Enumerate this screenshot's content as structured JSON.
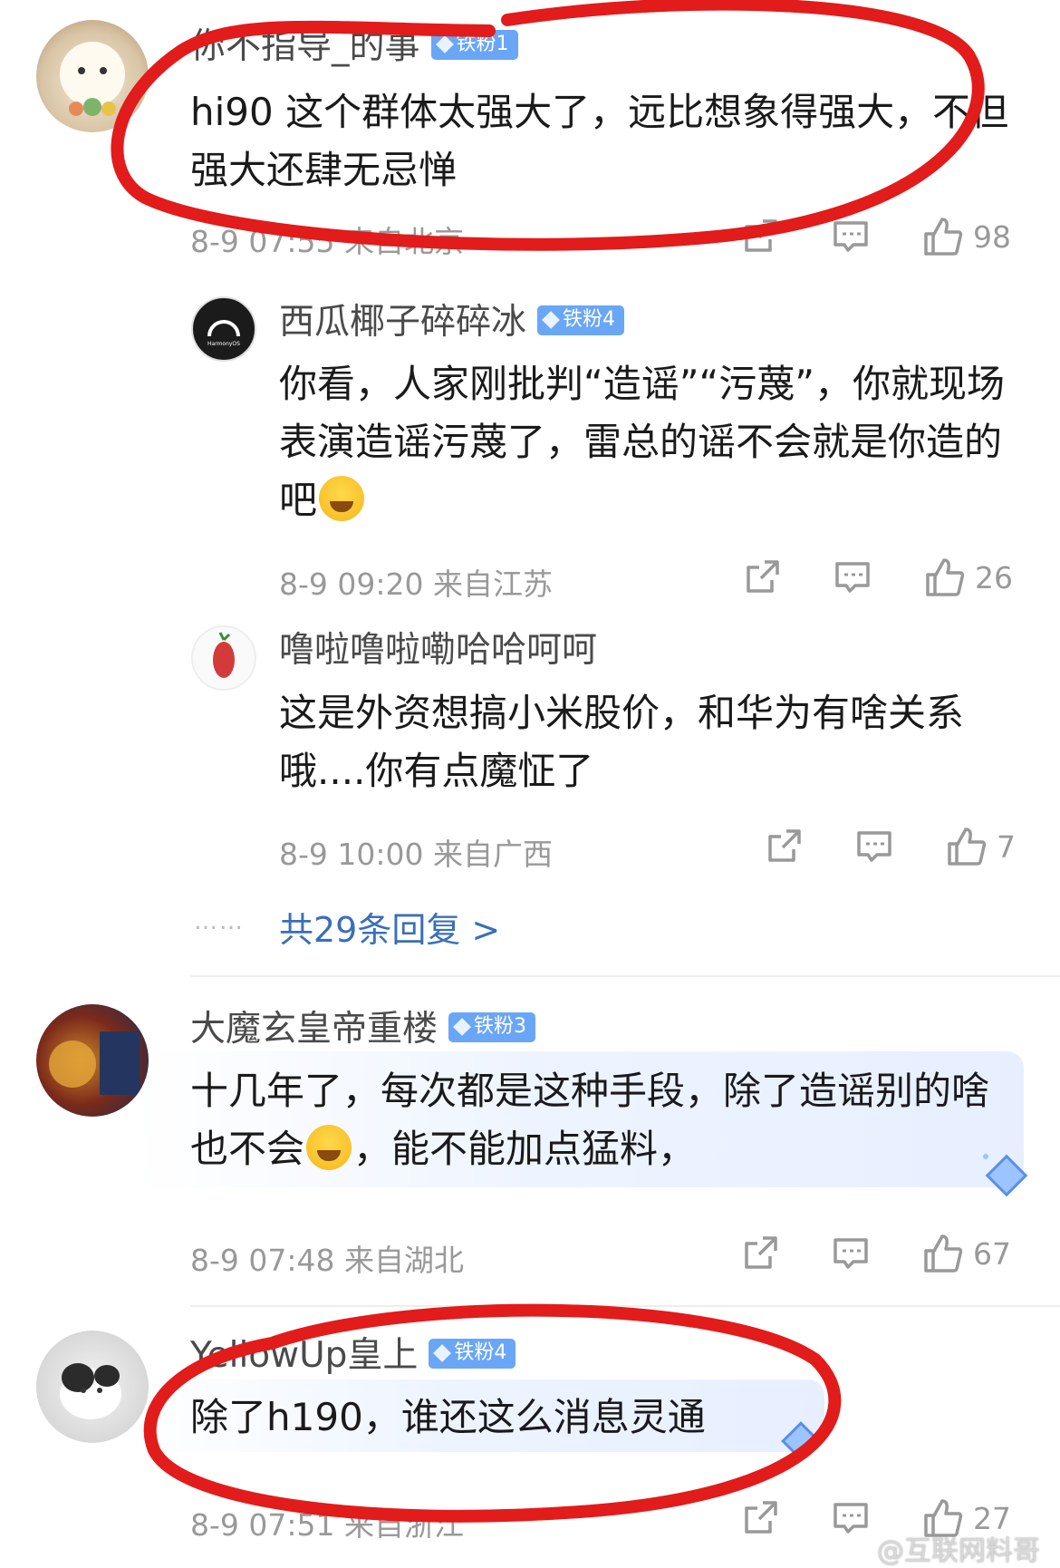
{
  "comments": [
    {
      "username": "你不指导_的事",
      "badge": "铁粉1",
      "text": "hi90 这个群体太强大了，远比想象得强大，不但强大还肆无忌惮",
      "time": "8-9 07:55",
      "location": "来自北京",
      "likes": "98"
    },
    {
      "username": "西瓜椰子碎碎冰",
      "badge": "铁粉4",
      "text_parts": [
        "你看，人家刚批判“造谣”“污蔑”，你就现场表演造谣污蔑了，雷总的谣不会就是你造的吧"
      ],
      "emoji": "laugh-cry",
      "time": "8-9 09:20",
      "location": "来自江苏",
      "likes": "26"
    },
    {
      "username": "噜啦噜啦嘞哈哈呵呵",
      "badge": "",
      "text": "这是外资想搞小米股价，和华为有啥关系哦....你有点魔怔了",
      "time": "8-9 10:00",
      "location": "来自广西",
      "likes": "7"
    },
    {
      "username": "大魔玄皇帝重楼",
      "badge": "铁粉3",
      "text_parts": [
        "十几年了，每次都是这种手段，除了造谣别的啥也不会",
        "，能不能加点猛料，"
      ],
      "emoji": "laugh-cry",
      "time": "8-9 07:48",
      "location": "来自湖北",
      "likes": "67"
    },
    {
      "username": "YellowUp皇上",
      "badge": "铁粉4",
      "text": "除了h190，谁还这么消息灵通",
      "time": "8-9 07:51",
      "location": "来自浙江",
      "likes": "27"
    }
  ],
  "replies_link": "共29条回复 >",
  "more_dots": "……",
  "watermark": "@互联网料哥",
  "icons": {
    "share": "share-icon",
    "comment": "comment-icon",
    "like": "thumbs-up-icon",
    "badge": "diamond-icon"
  },
  "colors": {
    "annotation": "#e21b1b",
    "badge": "#6aa6f6",
    "link": "#3a6fb8"
  }
}
